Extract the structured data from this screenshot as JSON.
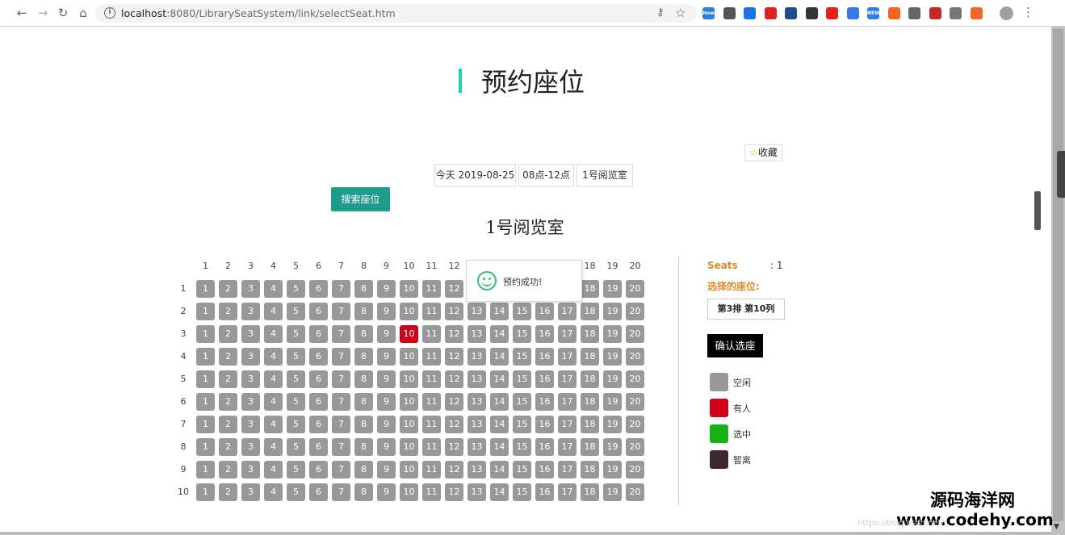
{
  "browser": {
    "url_host": "localhost",
    "url_rest": ":8080/LibrarySeatSystem/link/selectSeat.htm",
    "extensions": [
      {
        "name": "new-extension-icon",
        "color": "#2d7be5",
        "label": "New"
      },
      {
        "name": "extension-icon-2",
        "color": "#555555",
        "label": ""
      },
      {
        "name": "download-extension-icon",
        "color": "#1a73e8",
        "label": ""
      },
      {
        "name": "opera-extension-icon",
        "color": "#e0201f",
        "label": ""
      },
      {
        "name": "extension-icon-5",
        "color": "#1b4f8a",
        "label": ""
      },
      {
        "name": "extension-icon-6",
        "color": "#333333",
        "label": ""
      },
      {
        "name": "youtube-extension-icon",
        "color": "#e62117",
        "label": ""
      },
      {
        "name": "extension-icon-8",
        "color": "#3b78e7",
        "label": ""
      },
      {
        "name": "new-extension-icon-2",
        "color": "#2d7be5",
        "label": "NEW"
      },
      {
        "name": "extension-icon-10",
        "color": "#f26522",
        "label": ""
      },
      {
        "name": "infinity-extension-icon",
        "color": "#666666",
        "label": ""
      },
      {
        "name": "extension-icon-12",
        "color": "#c62828",
        "label": ""
      },
      {
        "name": "camera-extension-icon",
        "color": "#777777",
        "label": ""
      },
      {
        "name": "extension-icon-14",
        "color": "#f26522",
        "label": ""
      }
    ]
  },
  "page": {
    "title": "预约座位",
    "favorite_label": "收藏",
    "filters": {
      "date": "今天 2019-08-25",
      "time": "08点-12点",
      "room": "1号阅览室"
    },
    "search_button": "搜索座位",
    "room_title": "1号阅览室"
  },
  "seatmap": {
    "columns": 20,
    "rows": 10,
    "taken": [
      [
        3,
        10
      ]
    ]
  },
  "toast": {
    "message": "预约成功!"
  },
  "panel": {
    "seats_label": "Seats",
    "seats_count": ": 1",
    "chosen_label": "选择的座位:",
    "chosen_seat": "第3排 第10列",
    "confirm_button": "确认选座",
    "legend": [
      {
        "label": "空闲",
        "color": "#989898"
      },
      {
        "label": "有人",
        "color": "#d0021b"
      },
      {
        "label": "选中",
        "color": "#17b117"
      },
      {
        "label": "暂离",
        "color": "#3d2631"
      }
    ]
  },
  "watermark": {
    "line1": "源码海洋网",
    "line2": "www.codehy.com",
    "faint": "https://blog.csdn.net/"
  }
}
